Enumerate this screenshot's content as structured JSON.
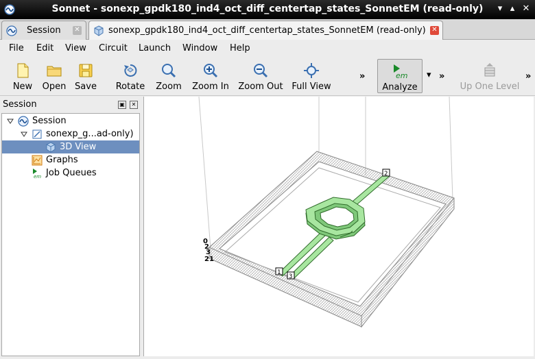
{
  "window": {
    "title": "Sonnet - sonexp_gpdk180_ind4_oct_diff_centertap_states_SonnetEM (read-only)",
    "controls": [
      "▾",
      "▴",
      "✕"
    ]
  },
  "tabs": [
    {
      "label": "Session",
      "icon": "sonnet-wave-icon",
      "active": false
    },
    {
      "label": "sonexp_gpdk180_ind4_oct_diff_centertap_states_SonnetEM (read-only)",
      "icon": "cube-icon",
      "active": true
    }
  ],
  "menu": [
    "File",
    "Edit",
    "View",
    "Circuit",
    "Launch",
    "Window",
    "Help"
  ],
  "toolbar": {
    "new": "New",
    "open": "Open",
    "save": "Save",
    "rotate": "Rotate",
    "zoom": "Zoom",
    "zoom_in": "Zoom In",
    "zoom_out": "Zoom Out",
    "full_view": "Full View",
    "overflow": "»",
    "analyze": "Analyze",
    "analyze_icon_text": "em",
    "dropdown": "▾",
    "overflow2": "»",
    "up_one_level": "Up One Level",
    "overflow3": "»"
  },
  "session_panel": {
    "title": "Session",
    "tree": [
      {
        "label": "Session",
        "icon": "sonnet-wave-icon",
        "level": 0,
        "expanded": true
      },
      {
        "label": "sonexp_g...ad-only)",
        "icon": "project-icon",
        "level": 1,
        "expanded": true
      },
      {
        "label": "3D View",
        "icon": "cube-icon",
        "level": 2,
        "selected": true
      },
      {
        "label": "Graphs",
        "icon": "graph-icon",
        "level": 1
      },
      {
        "label": "Job Queues",
        "icon": "em-icon",
        "level": 1
      }
    ]
  },
  "view3d": {
    "ports": [
      "2",
      "1",
      "3"
    ],
    "stack_labels": [
      "0",
      "2",
      "3",
      "21"
    ],
    "colors": {
      "metal": "#a8e6a0",
      "metal_edge": "#2f6b2a",
      "box": "#888888"
    }
  }
}
